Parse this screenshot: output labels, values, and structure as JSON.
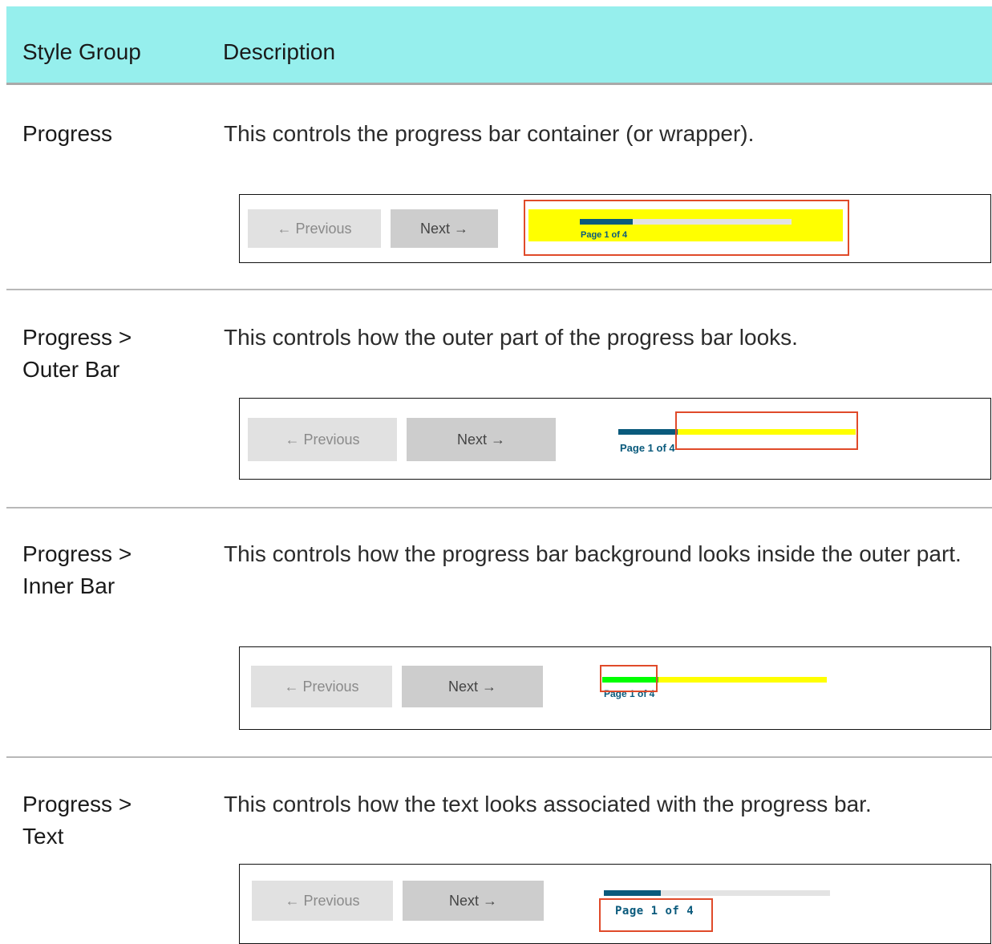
{
  "header": {
    "col1": "Style Group",
    "col2": "Description"
  },
  "rows": [
    {
      "group_line1": "Progress",
      "group_line2": "",
      "description": "This controls the progress bar container (or wrapper)."
    },
    {
      "group_line1": "Progress >",
      "group_line2": "Outer Bar",
      "description": "This controls how the outer part of the progress bar looks."
    },
    {
      "group_line1": "Progress >",
      "group_line2": "Inner Bar",
      "description": "This controls how the progress bar background looks inside the outer part."
    },
    {
      "group_line1": "Progress >",
      "group_line2": "Text",
      "description": "This controls how the text looks associated with the progress bar."
    }
  ],
  "example": {
    "previous_label": "← Previous",
    "next_label": "Next →",
    "page_text": "Page 1 of 4",
    "progress_fraction": 0.25
  },
  "colors": {
    "header_bg": "#96efed",
    "highlight": "#e04a2a",
    "container_yellow": "#ffff00",
    "inner_bar": "#0a5a7c",
    "inner_green": "#00ff00",
    "outer_track": "#e3e3e3"
  }
}
